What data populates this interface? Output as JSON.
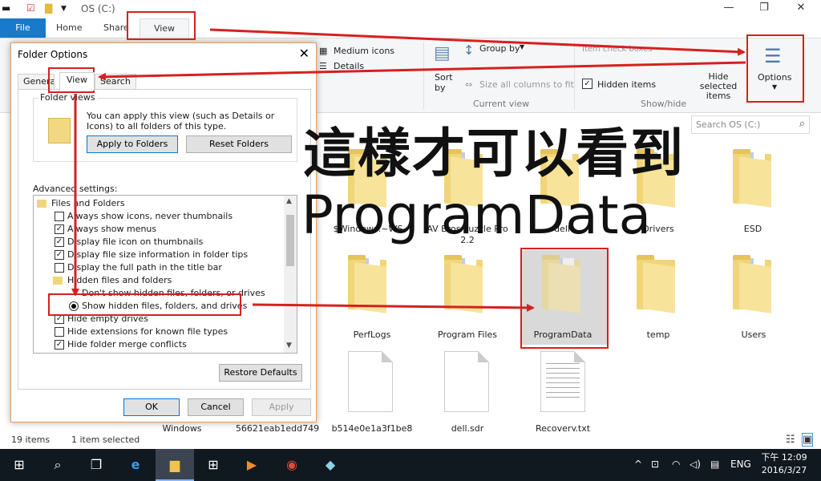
{
  "window": {
    "title": "OS (C:)",
    "controls": [
      "minimize",
      "maximize",
      "close"
    ]
  },
  "ribbon": {
    "tabs": [
      "File",
      "Home",
      "Share",
      "View"
    ],
    "active_tab": "View",
    "layout": {
      "medium_icons": "Medium icons",
      "details": "Details"
    },
    "current_view": {
      "sort_by": "Sort\nby",
      "group_by": "Group by",
      "size_all_columns": "Size all columns to fit",
      "label": "Current view"
    },
    "show_hide": {
      "item_check_boxes": "Item check boxes",
      "hidden_items": "Hidden items",
      "hidden_items_checked": true,
      "hide_selected_items": "Hide selected items",
      "label": "Show/hide"
    },
    "options_label": "Options"
  },
  "search": {
    "placeholder": "Search OS (C:)"
  },
  "files": [
    {
      "name": "$Windows.~WS",
      "type": "folder"
    },
    {
      "name": "AV Bros Puzzle Pro 2.2",
      "type": "folder"
    },
    {
      "name": "dell",
      "type": "folder"
    },
    {
      "name": "Drivers",
      "type": "folder"
    },
    {
      "name": "ESD",
      "type": "folder"
    },
    {
      "name": "PerfLogs",
      "type": "folder"
    },
    {
      "name": "Program Files",
      "type": "folder"
    },
    {
      "name": "ProgramData",
      "type": "folder",
      "selected": true,
      "hidden": true
    },
    {
      "name": "temp",
      "type": "folder"
    },
    {
      "name": "Users",
      "type": "folder"
    },
    {
      "name": "Windows",
      "type": "folder"
    },
    {
      "name": "56621eab1edd749",
      "type": "file"
    },
    {
      "name": "b514e0e1a3f1be8",
      "type": "file"
    },
    {
      "name": "dell.sdr",
      "type": "file"
    },
    {
      "name": "Recovery.txt",
      "type": "file"
    }
  ],
  "statusbar": {
    "items": "19 items",
    "selected": "1 item selected"
  },
  "dialog": {
    "title": "Folder Options",
    "tabs": [
      "General",
      "View",
      "Search"
    ],
    "active_tab": "View",
    "folder_views": {
      "legend": "Folder views",
      "description": "You can apply this view (such as Details or Icons) to all folders of this type.",
      "apply_button": "Apply to Folders",
      "reset_button": "Reset Folders"
    },
    "advanced": {
      "label": "Advanced settings:",
      "items": [
        {
          "kind": "folder",
          "label": "Files and Folders"
        },
        {
          "kind": "checkbox",
          "label": "Always show icons, never thumbnails",
          "checked": false
        },
        {
          "kind": "checkbox",
          "label": "Always show menus",
          "checked": true
        },
        {
          "kind": "checkbox",
          "label": "Display file icon on thumbnails",
          "checked": true
        },
        {
          "kind": "checkbox",
          "label": "Display file size information in folder tips",
          "checked": true
        },
        {
          "kind": "checkbox",
          "label": "Display the full path in the title bar",
          "checked": false
        },
        {
          "kind": "folder",
          "label": "Hidden files and folders"
        },
        {
          "kind": "radio",
          "label": "Don't show hidden files, folders, or drives",
          "checked": false
        },
        {
          "kind": "radio",
          "label": "Show hidden files, folders, and drives",
          "checked": true
        },
        {
          "kind": "checkbox",
          "label": "Hide empty drives",
          "checked": true
        },
        {
          "kind": "checkbox",
          "label": "Hide extensions for known file types",
          "checked": false
        },
        {
          "kind": "checkbox",
          "label": "Hide folder merge conflicts",
          "checked": true
        }
      ]
    },
    "restore_defaults": "Restore Defaults",
    "ok": "OK",
    "cancel": "Cancel",
    "apply": "Apply"
  },
  "annotation": {
    "line1": "這樣才可以看到",
    "line2": "ProgramData",
    "color": "#d62020"
  },
  "taskbar": {
    "apps": [
      "start-icon",
      "search-icon",
      "task-view-icon",
      "edge-icon",
      "file-explorer-icon",
      "store-icon",
      "media-player-icon",
      "chrome-icon",
      "app-icon"
    ],
    "lang": "ENG",
    "time": "下午 12:09",
    "date": "2016/3/27"
  }
}
